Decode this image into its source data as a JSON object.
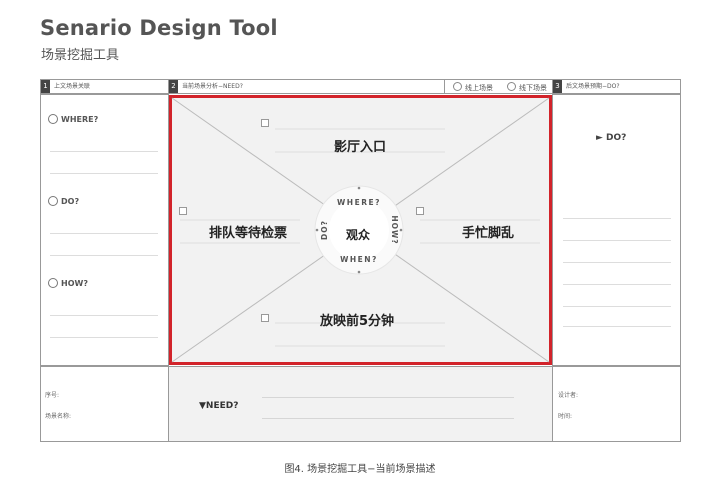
{
  "header": {
    "title_en": "Senario Design Tool",
    "title_cn": "场景挖掘工具"
  },
  "columns": {
    "col1": {
      "number": "1",
      "label": "上文场景关联"
    },
    "col2": {
      "number": "2",
      "label": "当前场景分析−NEED?",
      "options": [
        "线上场景",
        "线下场景"
      ]
    },
    "col3": {
      "number": "3",
      "label": "后文场景预期−DO?"
    }
  },
  "left_panel": {
    "items": [
      "WHERE?",
      "DO?",
      "HOW?"
    ]
  },
  "center": {
    "hub_label": "观众",
    "ring_words": [
      "WHERE?",
      "HOW?",
      "WHEN?",
      "DO?"
    ],
    "top_scene": "影厅入口",
    "left_scene": "排队等待检票",
    "right_scene": "手忙脚乱",
    "bottom_scene": "放映前5分钟"
  },
  "right_panel": {
    "do_label": "► DO?"
  },
  "bottom": {
    "left_fields": [
      "序号:",
      "场景名称:"
    ],
    "need_label": "▼NEED?",
    "right_fields": [
      "设计者:",
      "时间:"
    ]
  },
  "caption": "图4. 场景挖掘工具−当前场景描述",
  "colors": {
    "highlight": "#d2232a",
    "panel_fill": "#f2f2f2",
    "text_dark": "#222222"
  }
}
